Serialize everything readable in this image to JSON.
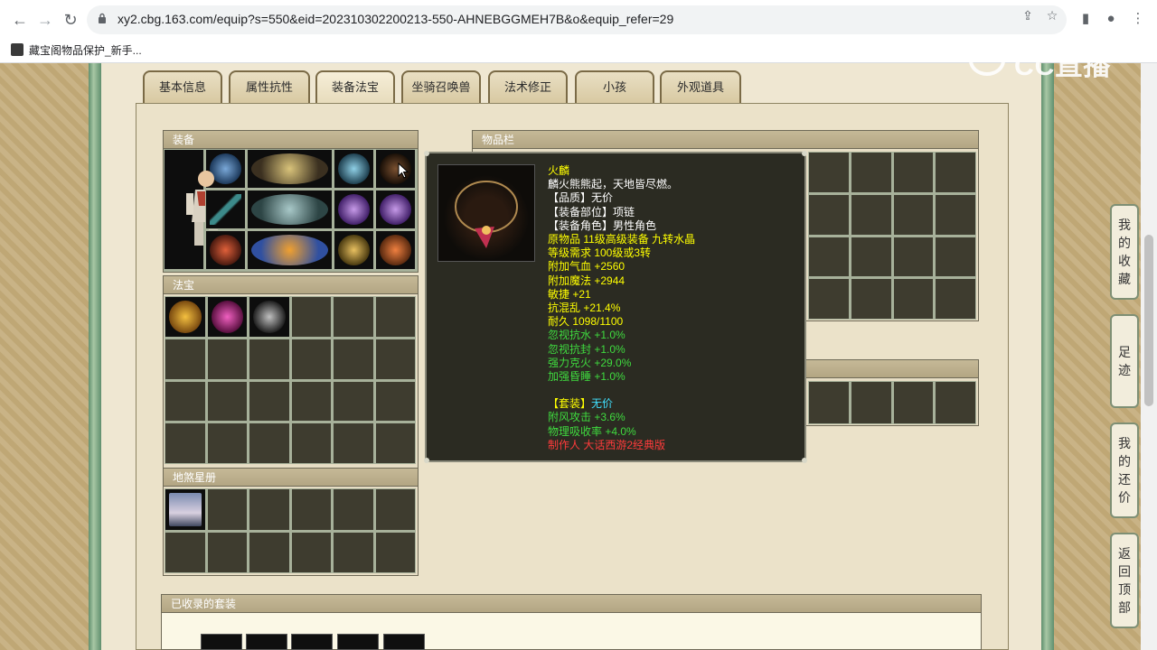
{
  "browser": {
    "url": "xy2.cbg.163.com/equip?s=550&eid=202310302200213-550-AHNEBGGMEH7B&o&equip_refer=29",
    "bookmark": "藏宝阁物品保护_新手..."
  },
  "tabs": [
    {
      "label": "基本信息"
    },
    {
      "label": "属性抗性"
    },
    {
      "label": "装备法宝"
    },
    {
      "label": "坐骑召唤兽"
    },
    {
      "label": "法术修正"
    },
    {
      "label": "小孩"
    },
    {
      "label": "外观道具"
    }
  ],
  "active_tab": "装备法宝",
  "sections": {
    "equipment": "装备",
    "treasure": "法宝",
    "star_book": "地煞星册",
    "inventory": "物品栏",
    "collected_sets": "已收录的套装"
  },
  "tooltip": {
    "name": "火麟",
    "desc": "麟火熊熊起，天地皆尽燃。",
    "quality": "【品质】无价",
    "slot": "【装备部位】项链",
    "role": "【装备角色】男性角色",
    "origin": "原物品 11级高级装备 九转水晶",
    "level_req": "等级需求 100级或3转",
    "hp": "附加气血 +2560",
    "mp": "附加魔法 +2944",
    "agi": "敏捷 +21",
    "resist_chaos": "抗混乱 +21.4%",
    "durability": "耐久 1098/1100",
    "ignore_water": "忽视抗水 +1.0%",
    "ignore_seal": "忽视抗封 +1.0%",
    "fire_counter": "强力克火 +29.0%",
    "sleep_boost": "加强昏睡 +1.0%",
    "set_label": "【套装】",
    "set_value": "无价",
    "wind_attack": "附风攻击 +3.6%",
    "phys_absorb": "物理吸收率 +4.0%",
    "maker": "制作人 大话西游2经典版"
  },
  "float_nav": [
    {
      "label": "我的收藏",
      "chars": [
        "我",
        "的",
        "收",
        "藏"
      ]
    },
    {
      "label": "足迹",
      "chars": [
        "足",
        "迹"
      ]
    },
    {
      "label": "我的还价",
      "chars": [
        "我",
        "的",
        "还",
        "价"
      ]
    },
    {
      "label": "返回顶部",
      "chars": [
        "返",
        "回",
        "顶",
        "部"
      ]
    }
  ],
  "logo_text": "CC直播",
  "colors": {
    "tooltip_bg": "#2b2b22",
    "title_yellow": "#ffff00",
    "stat_green": "#3fdb3f",
    "set_cyan": "#40e0ff",
    "maker_red": "#ff3b3b"
  }
}
